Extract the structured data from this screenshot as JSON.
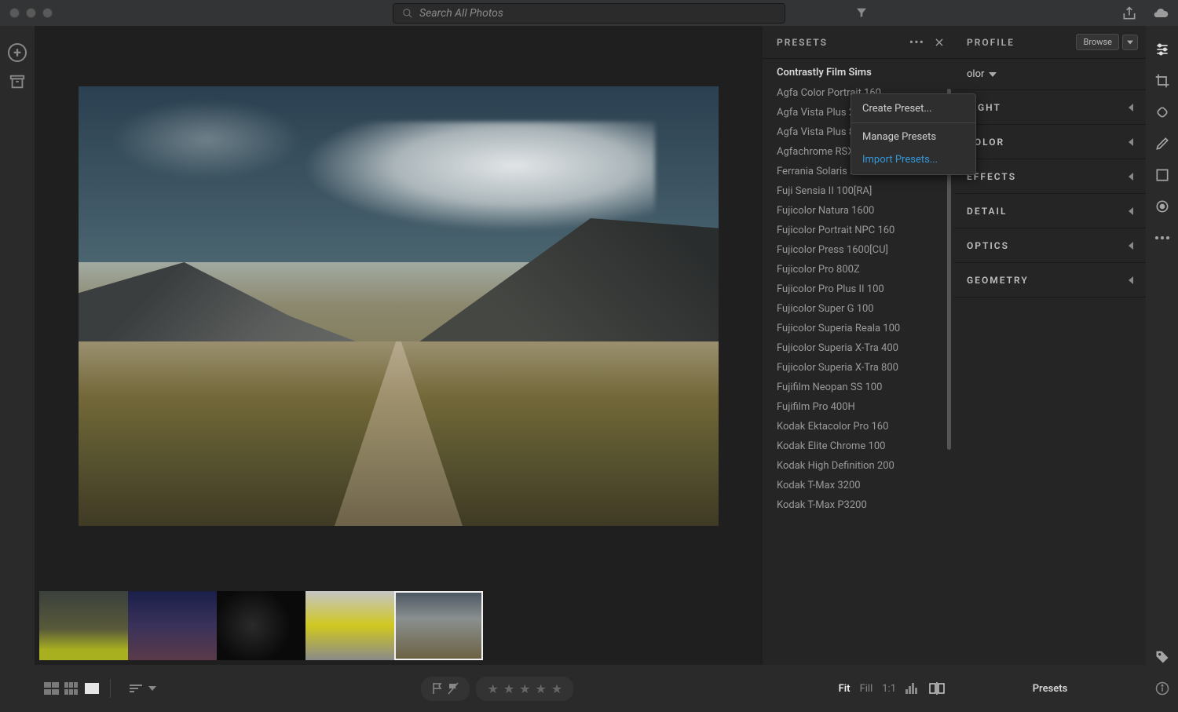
{
  "search": {
    "placeholder": "Search All Photos"
  },
  "presets": {
    "title": "PRESETS",
    "group": "Contrastly Film Sims",
    "items": [
      "Agfa Color Portrait 160",
      "Agfa Vista Plus 200",
      "Agfa Vista Plus 800",
      "Agfachrome RSX II 200",
      "Ferrania Solaris FG PLUS 100",
      "Fuji Sensia II 100[RA]",
      "Fujicolor Natura 1600",
      "Fujicolor Portrait NPC 160",
      "Fujicolor Press 1600[CU]",
      "Fujicolor Pro 800Z",
      "Fujicolor Pro Plus II 100",
      "Fujicolor Super G 100",
      "Fujicolor Superia Reala 100",
      "Fujicolor Superia X-Tra 400",
      "Fujicolor Superia X-Tra 800",
      "Fujifilm Neopan SS 100",
      "Fujifilm Pro 400H",
      "Kodak Ektacolor Pro 160",
      "Kodak Elite Chrome 100",
      "Kodak High Definition 200",
      "Kodak T-Max 3200",
      "Kodak T-Max P3200"
    ]
  },
  "popup": {
    "create": "Create Preset...",
    "manage": "Manage Presets",
    "import": "Import Presets..."
  },
  "edit": {
    "profile_label": "PROFILE",
    "browse": "Browse",
    "profile_value": "olor",
    "sections": [
      "LIGHT",
      "COLOR",
      "EFFECTS",
      "DETAIL",
      "OPTICS",
      "GEOMETRY"
    ]
  },
  "status": {
    "fit": "Fit",
    "fill": "Fill",
    "oneone": "1:1",
    "presets_btn": "Presets"
  }
}
